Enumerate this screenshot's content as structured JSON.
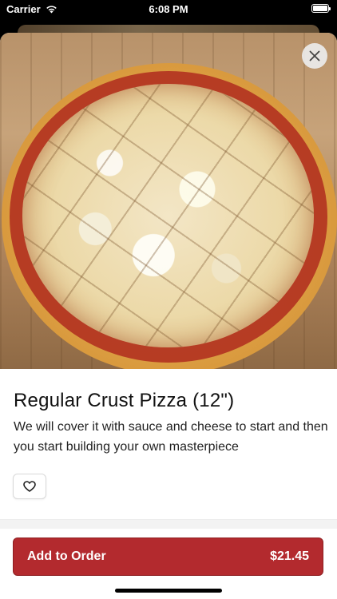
{
  "status_bar": {
    "carrier": "Carrier",
    "time": "6:08 PM",
    "battery_level": 1.0
  },
  "item": {
    "photo_icon": "pizza-photo",
    "title": "Regular Crust Pizza (12\")",
    "description": "We will cover it with sauce and cheese to start and then you start building your own masterpiece"
  },
  "actions": {
    "close_icon": "close-icon",
    "favorite_icon": "heart-outline-icon",
    "add_label": "Add to Order",
    "price": "$21.45"
  },
  "colors": {
    "accent": "#b32a2e",
    "sheet_background": "#ffffff",
    "text_primary": "#111111"
  }
}
